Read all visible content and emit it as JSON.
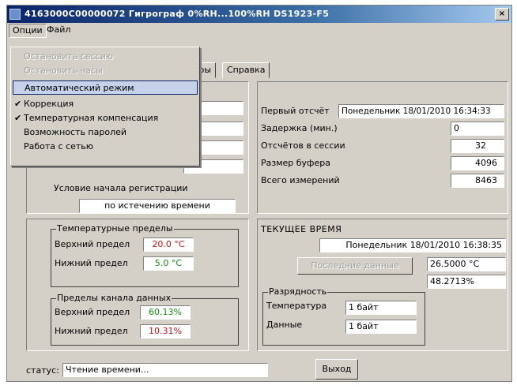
{
  "window": {
    "title": "4163000C00000072   Гигрограф 0%RH...100%RH   DS1923-F5",
    "close_glyph": "×"
  },
  "menubar": {
    "options_label": "Опции",
    "file_label": "Файл"
  },
  "dropdown": {
    "items": [
      {
        "label": "Остановить сессию",
        "state": "disabled"
      },
      {
        "label": "Остановить часы",
        "state": "disabled"
      },
      {
        "label": "Автоматический режим",
        "state": "highlighted"
      },
      {
        "label": "Коррекция",
        "state": "checked"
      },
      {
        "label": "Температурная компенсация",
        "state": "checked"
      },
      {
        "label": "Возможность паролей",
        "state": "normal"
      },
      {
        "label": "Работа с сетью",
        "state": "normal"
      }
    ],
    "check_glyph": "✔"
  },
  "tabs": {
    "params_partial": "тры",
    "help": "Справка"
  },
  "session": {
    "start_condition_label": "Условие начала регистрации",
    "start_condition_value": "по истечению времени"
  },
  "report": {
    "first_report_label": "Первый отсчёт",
    "first_report_value": "Понедельник 18/01/2010 16:34:33",
    "delay_label": "Задержка (мин.)",
    "delay_value": "0",
    "readings_label": "Отсчётов в сессии",
    "readings_value": "32",
    "buffer_label": "Размер буфера",
    "buffer_value": "4096",
    "total_label": "Всего измерений",
    "total_value": "8463"
  },
  "limits": {
    "temp_group_title": "Температурные пределы",
    "temp_upper_label": "Верхний предел",
    "temp_upper_value": "20.0 °C",
    "temp_lower_label": "Нижний предел",
    "temp_lower_value": "5.0 °C",
    "data_group_title": "Пределы канала данных",
    "data_upper_label": "Верхний предел",
    "data_upper_value": "60.13%",
    "data_lower_label": "Нижний предел",
    "data_lower_value": "10.31%"
  },
  "current_time": {
    "title": "ТЕКУЩЕЕ ВРЕМЯ",
    "datetime": "Понедельник 18/01/2010 16:38:35",
    "last_data_button": "Последние данные",
    "temp_value": "26.5000 °C",
    "humidity_value": "48.2713%",
    "resolution_title": "Разрядность",
    "temperature_label": "Температура",
    "temperature_value": "1 байт",
    "data_label": "Данные",
    "data_value": "1 байт"
  },
  "status": {
    "label": "статус:",
    "value": "Чтение времени...",
    "exit_button": "Выход"
  },
  "colors": {
    "limit_high": "#d01010",
    "limit_low": "#109010"
  }
}
